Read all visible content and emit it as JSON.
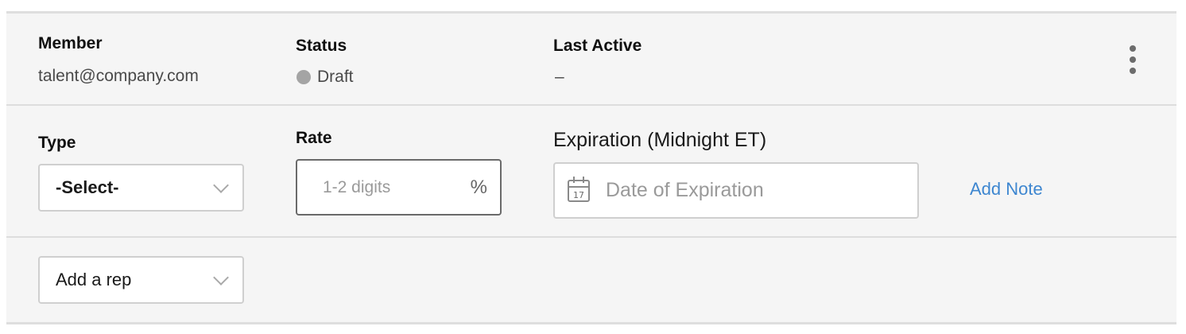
{
  "header": {
    "member": {
      "label": "Member",
      "value": "talent@company.com"
    },
    "status": {
      "label": "Status",
      "value": "Draft",
      "dot_color": "#a4a4a4"
    },
    "last_active": {
      "label": "Last Active",
      "value": "–"
    },
    "menu_icon": "kebab-vertical-icon"
  },
  "form": {
    "type": {
      "label": "Type",
      "selected": "-Select-"
    },
    "rate": {
      "label": "Rate",
      "placeholder": "1-2 digits",
      "suffix": "%"
    },
    "expiration": {
      "label": "Expiration (Midnight ET)",
      "placeholder": "Date of Expiration",
      "icon": "calendar-icon",
      "icon_day": "17"
    },
    "add_note": "Add Note"
  },
  "rep": {
    "selected": "Add a rep"
  },
  "colors": {
    "link": "#3d86d0",
    "background": "#f5f5f5",
    "border": "#cfcfcf"
  }
}
